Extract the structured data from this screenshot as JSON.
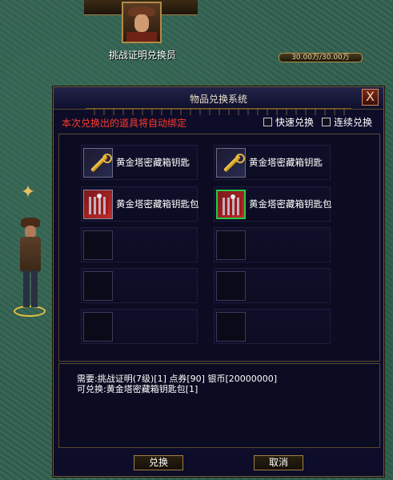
{
  "npc": {
    "name": "挑战证明兑换员",
    "hp_text": "30.00万/30.00万"
  },
  "window": {
    "title": "物品兑换系统",
    "close_label": "X",
    "notice": "本次兑换出的道具将自动绑定",
    "fast_exchange_label": "快速兑换",
    "continuous_exchange_label": "连续兑换"
  },
  "slots": [
    {
      "label": "黄金塔密藏箱钥匙",
      "icon": "golden-key-icon"
    },
    {
      "label": "黄金塔密藏箱钥匙",
      "icon": "golden-key-icon"
    },
    {
      "label": "黄金塔密藏箱钥匙包",
      "icon": "gift-box-icon"
    },
    {
      "label": "黄金塔密藏箱钥匙包",
      "icon": "gift-box-icon"
    },
    {
      "label": "",
      "icon": ""
    },
    {
      "label": "",
      "icon": ""
    },
    {
      "label": "",
      "icon": ""
    },
    {
      "label": "",
      "icon": ""
    },
    {
      "label": "",
      "icon": ""
    },
    {
      "label": "",
      "icon": ""
    }
  ],
  "detail": {
    "line1": "需要:挑战证明(7级)[1] 点券[90] 银币[20000000]",
    "line2": "可兑换:黄金塔密藏箱钥匙包[1]"
  },
  "buttons": {
    "exchange": "兑换",
    "cancel": "取消"
  },
  "colors": {
    "notice": "#ff3a2a",
    "window_bg": "#0d0d2a",
    "border_gold": "#a08040",
    "selected_slot": "#2ac84a"
  }
}
